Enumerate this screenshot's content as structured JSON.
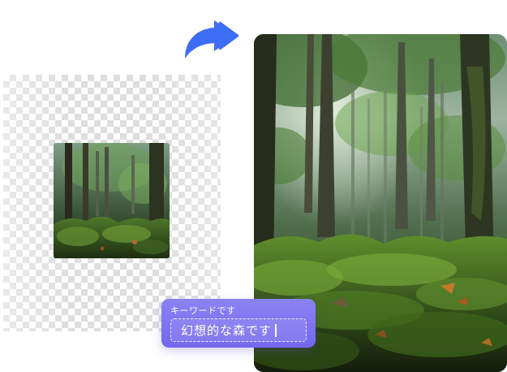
{
  "source_canvas": {
    "background": "transparent-checkerboard"
  },
  "result_image": {
    "subject": "forest"
  },
  "transform_arrow": {
    "icon": "curved-arrow-right-icon",
    "color": "#3d6cf5"
  },
  "prompt": {
    "label": "キーワードです",
    "value": "幻想的な森です",
    "accent_color": "#7a6ef0"
  }
}
